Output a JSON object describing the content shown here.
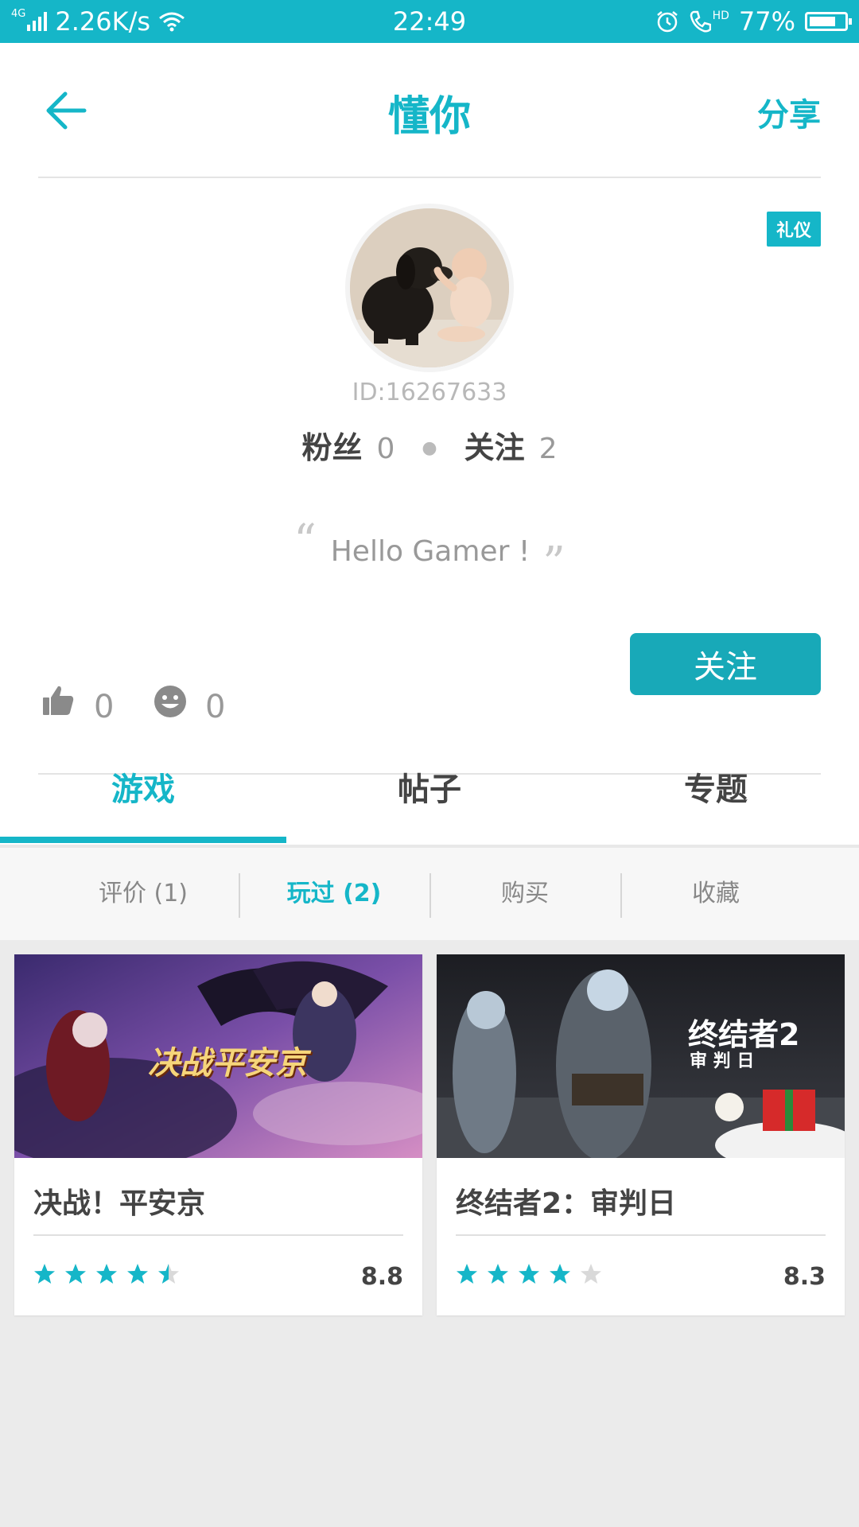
{
  "status_bar": {
    "network": "4G",
    "speed": "2.26K/s",
    "time": "22:49",
    "hd": "HD",
    "battery": "77%",
    "battery_level": 0.77
  },
  "header": {
    "title": "懂你",
    "share_label": "分享",
    "back_icon": "arrow-left-icon"
  },
  "profile": {
    "badge": "礼仪",
    "user_id": "ID:16267633",
    "fans_label": "粉丝",
    "fans_count": "0",
    "following_label": "关注",
    "following_count": "2",
    "motto": "Hello Gamer !",
    "likes_count": "0",
    "smiles_count": "0",
    "follow_button": "关注"
  },
  "tabs": [
    {
      "label": "游戏",
      "active": true
    },
    {
      "label": "帖子",
      "active": false
    },
    {
      "label": "专题",
      "active": false
    }
  ],
  "subtabs": [
    {
      "label": "评价 (1)",
      "active": false
    },
    {
      "label": "玩过 (2)",
      "active": true
    },
    {
      "label": "购买",
      "active": false
    },
    {
      "label": "收藏",
      "active": false
    }
  ],
  "games": [
    {
      "title": "决战！平安京",
      "image_text": "决战平安京",
      "score": "8.8",
      "rating": 4.5
    },
    {
      "title": "终结者2：审判日",
      "image_text": "终结者2",
      "image_subtext": "审 判 日",
      "score": "8.3",
      "rating": 4.0
    }
  ],
  "colors": {
    "accent": "#15b6c8",
    "button": "#18a9b8",
    "background": "#ebebeb"
  }
}
